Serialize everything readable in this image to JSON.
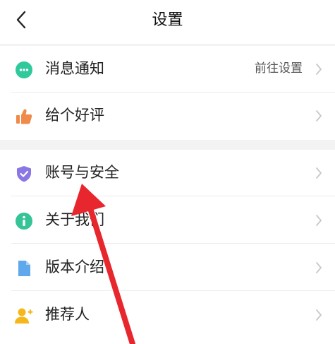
{
  "header": {
    "title": "设置"
  },
  "group1": [
    {
      "label": "消息通知",
      "value": "前往设置",
      "icon": "chat-bubble-icon",
      "color": "#2fc99c"
    },
    {
      "label": "给个好评",
      "value": "",
      "icon": "thumbs-up-icon",
      "color": "#f08a4b"
    }
  ],
  "group2": [
    {
      "label": "账号与安全",
      "value": "",
      "icon": "shield-icon",
      "color": "#8b76e6"
    },
    {
      "label": "关于我们",
      "value": "",
      "icon": "info-icon",
      "color": "#34c496"
    },
    {
      "label": "版本介绍",
      "value": "",
      "icon": "document-icon",
      "color": "#5fa8ec"
    },
    {
      "label": "推荐人",
      "value": "",
      "icon": "user-add-icon",
      "color": "#f5b81c"
    }
  ],
  "colors": {
    "background": "#f3f3f3",
    "annotation_arrow": "#e8262d"
  }
}
